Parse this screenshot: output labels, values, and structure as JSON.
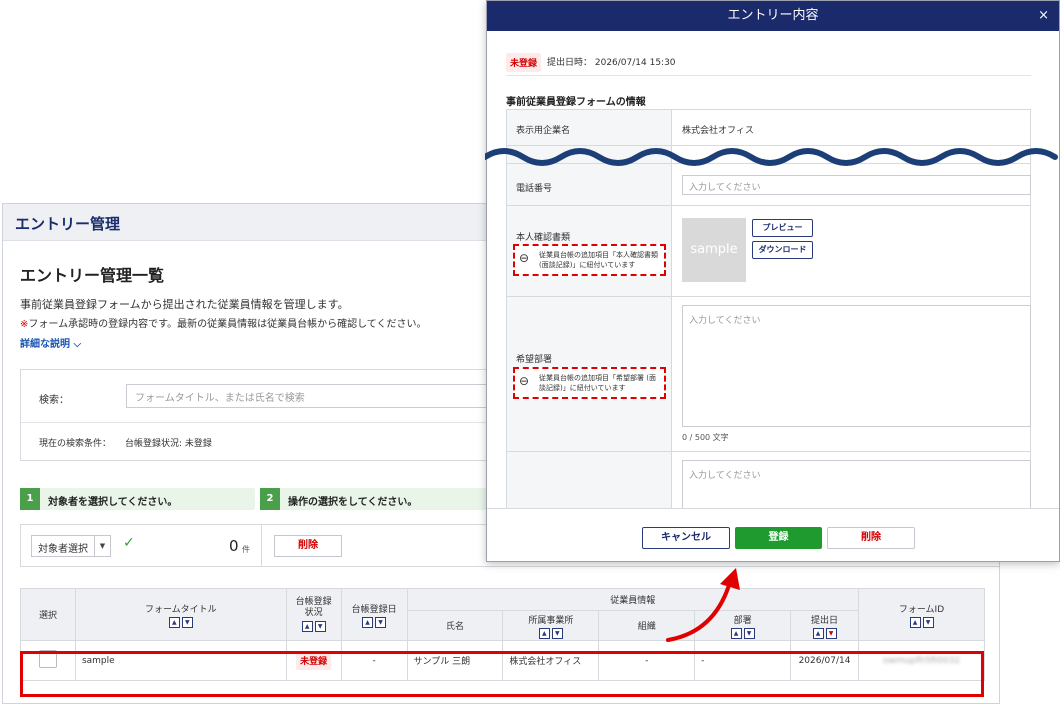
{
  "page": {
    "header_title": "エントリー管理",
    "title": "エントリー管理一覧",
    "description": "事前従業員登録フォームから提出された従業員情報を管理します。",
    "note_mark": "※",
    "note_text": "フォーム承認時の登録内容です。最新の従業員情報は従業員台帳から確認してください。",
    "detail_link": "詳細な説明 ⌵"
  },
  "search": {
    "label": "検索：",
    "placeholder": "フォームタイトル、または氏名で検索",
    "condition_label": "現在の検索条件：",
    "condition_value": "台帳登録状況: 未登録"
  },
  "steps": [
    {
      "num": "1",
      "label": "対象者を選択してください。"
    },
    {
      "num": "2",
      "label": "操作の選択をしてください。"
    }
  ],
  "actions": {
    "select_label": "対象者選択",
    "count": "0",
    "count_unit": "件",
    "delete_label": "削除"
  },
  "table": {
    "headers": {
      "select": "選択",
      "form_title": "フォームタイトル",
      "status": "台帳登録\n状況",
      "reg_date": "台帳登録日",
      "employee_info": "従業員情報",
      "name": "氏名",
      "office": "所属事業所",
      "org": "組織",
      "dept": "部署",
      "submit_date": "提出日",
      "form_id": "フォームID"
    },
    "row": {
      "form_title": "sample",
      "status": "未登録",
      "reg_date": "-",
      "name": "サンプル 三朗",
      "office": "株式会社オフィス",
      "org": "-",
      "dept": "-",
      "submit_date": "2026/07/14",
      "form_id": "owmupfh5ft0032"
    }
  },
  "modal": {
    "title": "エントリー内容",
    "close": "×",
    "status_badge": "未登録",
    "submitted": "提出日時： 2026/07/14 15:30",
    "section_title": "事前従業員登録フォームの情報",
    "fields": {
      "company_label": "表示用企業名",
      "company_value": "株式会社オフィス",
      "phone_label": "電話番号",
      "phone_placeholder": "入力してください",
      "id_doc_label": "本人確認書類",
      "id_doc_note": "従業員台帳の追加項目「本人確認書類 (面談記録)」に紐付いています",
      "sample_text": "sample",
      "preview_button": "プレビュー",
      "download_button": "ダウンロード",
      "dept_label": "希望部署",
      "dept_note": "従業員台帳の追加項目「希望部署 (面談記録)」に紐付いています",
      "dept_placeholder": "入力してください",
      "char_count": "0 / 500 文字",
      "extra_placeholder": "入力してください"
    },
    "footer": {
      "cancel": "キャンセル",
      "register": "登録",
      "delete": "削除"
    }
  },
  "colors": {
    "brand_navy": "#1b2a6b",
    "register_green": "#1f9a2e",
    "step_green": "#4aa04a",
    "highlight_red": "#e00000",
    "wave_blue": "#1d3f78"
  }
}
